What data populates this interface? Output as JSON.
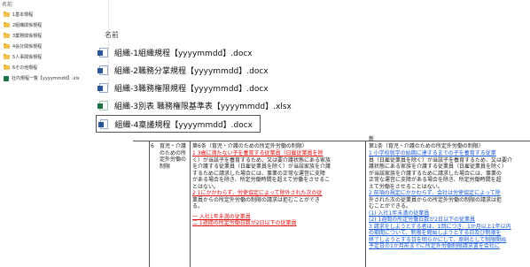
{
  "folder_pane": {
    "header": "名前",
    "items": [
      "1基本規程",
      "2組織関係規程",
      "3業務関係規程",
      "4会計関係規程",
      "5人事関係規程",
      "6その他規程",
      "社内規程一覧【yyyymmdd】.xls"
    ]
  },
  "file_list": {
    "column_header": "名前",
    "files": [
      {
        "name": "組織-1組織規程【yyyymmdd】.docx",
        "type": "word"
      },
      {
        "name": "組織-2職務分掌規程【yyyymmdd】.docx",
        "type": "word"
      },
      {
        "name": "組織-3職務権限規程【yyyymmdd】.docx",
        "type": "word"
      },
      {
        "name": "組織-3別表 職務権限基準表【yyyymmdd】.xlsx",
        "type": "excel"
      },
      {
        "name": "組織-4稟議規程【yyyymmdd】.docx",
        "type": "word"
      }
    ],
    "selected_index": 4
  },
  "document": {
    "new_header": "新",
    "row_number": "6",
    "title_cell": "育児・介護のための所定外労働の制限",
    "old_heading": "第6条（育児・介護のための所定外労働の制限）",
    "old_lines": [
      "1 3歳に満たない子を養育する従業員（日雇従業員を除",
      "く）が当該子を養育するため、又は要介護状態にある家族",
      "を介護する従業員（日雇従業員を除く）が当該家族を介護",
      "するために請求した場合には、事業の正常な運営に支障",
      "がある場合を除き、所定労働時間を超えて労働をさせるこ",
      "とはない。",
      "2 1にかかわらず、労使協定によって除外された次の従",
      "業員からの所定外労働の制限の請求は拒むことができ",
      "る。",
      "一 入社1年未満の従業員",
      "二 1週間の所定労働日数が2日以下の従業員"
    ],
    "new_heading": "第1条（育児・介護のための所定外労働の制限）",
    "new_lines": [
      "1 小学校就学の始期に達するまでの子を養育する従業",
      "員（日雇従業員を除く）が当該子を養育するため、又は要介",
      "護状態にある家族を介護する従業員（日雇従業員を除く）",
      "が当該家族を介護するために請求した場合には、事業の",
      "正常な運営に支障がある場合を除き、所定労働時間を超",
      "えて労働をさせることはない。",
      "2 前項の規定にかかわらず、会社は労使協定によって除",
      "外された次の従業員からの所定外労働の制限の請求は拒",
      "むことができる。",
      "(1) 入社1年未満の従業員",
      "(2) 1週間の所定労働日数が2日以下の従業員",
      "3 請求をしようとする者は、1回につき、1か月以上1年以内",
      "の期間について、制限を開始しようとする日及び制限を",
      "終了しようとする日を明らかにして、原則として制限開始",
      "予定日の1か月前までに所定外労働制限請求書を会社に"
    ]
  },
  "colors": {
    "folder": "#f2c14e",
    "word": "#2b5797",
    "excel": "#1e7145",
    "deleted_text": "#dd1111",
    "inserted_text": "#1a5bd6"
  }
}
